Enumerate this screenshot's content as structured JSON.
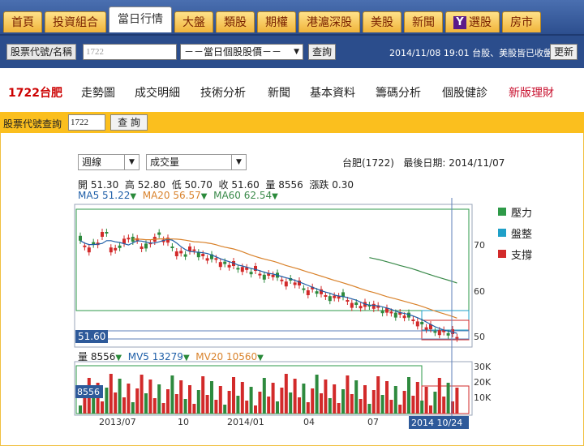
{
  "tabs": [
    {
      "label": "首頁",
      "active": false
    },
    {
      "label": "投資組合",
      "active": false
    },
    {
      "label": "當日行情",
      "active": true
    },
    {
      "label": "大盤",
      "active": false
    },
    {
      "label": "類股",
      "active": false
    },
    {
      "label": "期權",
      "active": false
    },
    {
      "label": "港滬深股",
      "active": false
    },
    {
      "label": "美股",
      "active": false
    },
    {
      "label": "新聞",
      "active": false
    },
    {
      "label": "選股",
      "active": false,
      "logo": "Y"
    },
    {
      "label": "房市",
      "active": false
    }
  ],
  "search": {
    "label_button": "股票代號/名稱",
    "input_value": "1722",
    "select_value": "－－當日個股股價－－",
    "submit": "查詢",
    "status": "2014/11/08 19:01 台股、美股皆已收盤",
    "refresh": "更新"
  },
  "subnav": {
    "stock": "1722台肥",
    "items": [
      "走勢圖",
      "成交明細",
      "技術分析",
      "新聞",
      "基本資料",
      "籌碼分析",
      "個股健診",
      "新版理財"
    ]
  },
  "query": {
    "label": "股票代號查詢",
    "input_value": "1722",
    "submit": "查 詢"
  },
  "chart_header": {
    "period": "週線",
    "indicator": "成交量",
    "stock_name": "台肥(1722)",
    "last_date_label": "最後日期:",
    "last_date": "2014/11/07"
  },
  "ohlc": {
    "open_label": "開",
    "open": "51.30",
    "high_label": "高",
    "high": "52.80",
    "low_label": "低",
    "low": "50.70",
    "close_label": "收",
    "close": "51.60",
    "vol_label": "量",
    "vol": "8556",
    "chg_label": "漲跌",
    "chg": "0.30"
  },
  "ma": {
    "ma5_label": "MA5",
    "ma5": "51.22",
    "ma20_label": "MA20",
    "ma20": "56.57",
    "ma60_label": "MA60",
    "ma60": "62.54"
  },
  "volume_info": {
    "vol_label": "量",
    "vol": "8556",
    "mv5_label": "MV5",
    "mv5": "13279",
    "mv20_label": "MV20",
    "mv20": "10560"
  },
  "legend": [
    {
      "label": "壓力",
      "color": "#2e9a48"
    },
    {
      "label": "盤整",
      "color": "#1fa0c8"
    },
    {
      "label": "支撐",
      "color": "#d22a2a"
    }
  ],
  "price_axis": [
    "70",
    "60",
    "50"
  ],
  "volume_axis": [
    "30K",
    "20K",
    "10K"
  ],
  "time_axis": [
    "2013/07",
    "10",
    "2014/01",
    "04",
    "07"
  ],
  "cursor": {
    "price": "51.60",
    "volume": "8556",
    "date": "2014 10/24"
  },
  "colors": {
    "up": "#d22a2a",
    "down": "#2e8a3e",
    "ma5": "#1f5fa8",
    "ma20": "#d9822b",
    "ma60": "#3a8a4a"
  }
}
